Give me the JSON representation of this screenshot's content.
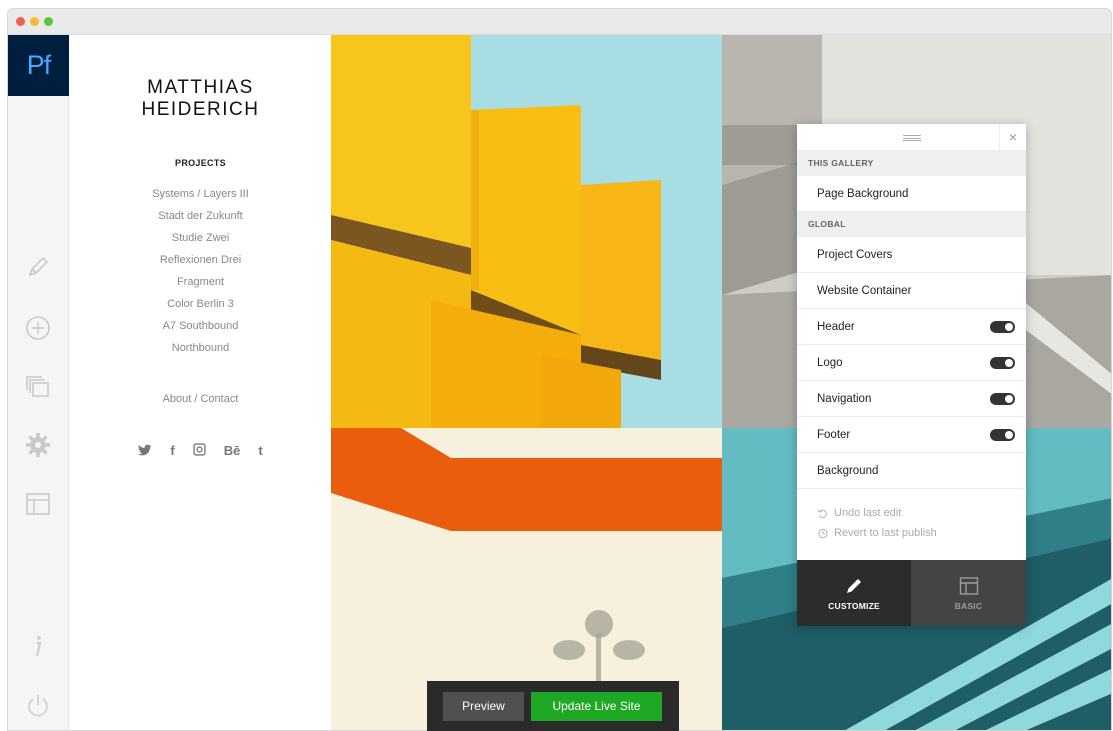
{
  "app": {
    "logo_text": "Pf",
    "accent_color": "#49a5ff",
    "logo_bg": "#001f3f"
  },
  "rail_icons": [
    "pencil-icon",
    "add-circle-icon",
    "pages-icon",
    "gear-icon",
    "layout-icon",
    "info-icon",
    "power-icon"
  ],
  "site": {
    "brand_line1": "MATTHIAS",
    "brand_line2": "HEIDERICH",
    "projects_heading": "PROJECTS",
    "projects": [
      "Systems / Layers III",
      "Stadt der Zukunft",
      "Studie Zwei",
      "Reflexionen Drei",
      "Fragment",
      "Color Berlin 3",
      "A7 Southbound",
      "Northbound"
    ],
    "about_link": "About / Contact",
    "social": {
      "twitter": "𝕥",
      "facebook": "f",
      "instagram": "◎",
      "behance": "Bē",
      "tumblr": "t"
    }
  },
  "panel": {
    "close_glyph": "×",
    "this_gallery_heading": "THIS GALLERY",
    "page_background": "Page Background",
    "global_heading": "GLOBAL",
    "rows": {
      "project_covers": "Project Covers",
      "website_container": "Website Container",
      "header": "Header",
      "logo": "Logo",
      "navigation": "Navigation",
      "footer": "Footer",
      "background": "Background"
    },
    "toggles": {
      "header": true,
      "logo": true,
      "navigation": true,
      "footer": true
    },
    "undo_label": "Undo last edit",
    "revert_label": "Revert to last publish",
    "tab_customize": "CUSTOMIZE",
    "tab_basic": "BASIC"
  },
  "publish": {
    "preview_label": "Preview",
    "update_label": "Update Live Site",
    "update_color": "#1fa824"
  }
}
